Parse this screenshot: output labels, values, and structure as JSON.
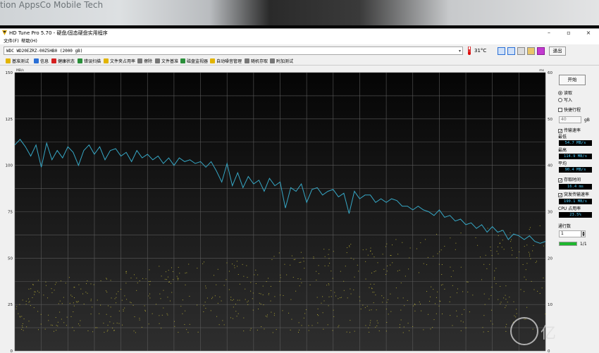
{
  "photo": {
    "text": "tion AppsCo Mobile Tech"
  },
  "window": {
    "title": "HD Tune Pro 5.70 - 硬盘/固态硬盘实用程序",
    "buttons": {
      "minimize": "–",
      "maximize": "▫",
      "close": "×"
    }
  },
  "menu": {
    "file": "文件(F)",
    "help": "帮助(H)"
  },
  "device": {
    "selected": "WDC WD20EZRZ-00Z5HB0 (2000 gB)",
    "temperature": "31°C",
    "exit_label": "退出"
  },
  "tabs": [
    {
      "label": "基准测试",
      "icon": "benchmark-icon",
      "color": "#e2b400"
    },
    {
      "label": "信息",
      "icon": "info-icon",
      "color": "#2a6fd6"
    },
    {
      "label": "健康状态",
      "icon": "health-icon",
      "color": "#d42020"
    },
    {
      "label": "错误扫描",
      "icon": "scan-icon",
      "color": "#2a8f3a"
    },
    {
      "label": "文件夹占用率",
      "icon": "folder-icon",
      "color": "#e2b400"
    },
    {
      "label": "擦除",
      "icon": "erase-icon",
      "color": "#777777"
    },
    {
      "label": "文件基准",
      "icon": "file-benchmark-icon",
      "color": "#777777"
    },
    {
      "label": "磁盘监视器",
      "icon": "monitor-icon",
      "color": "#2a8f3a"
    },
    {
      "label": "自动噪音管理",
      "icon": "noise-icon",
      "color": "#e2b400"
    },
    {
      "label": "随机存取",
      "icon": "random-access-icon",
      "color": "#777777"
    },
    {
      "label": "附加测试",
      "icon": "extra-tests-icon",
      "color": "#777777"
    }
  ],
  "panel": {
    "start_label": "开始",
    "read_label": "读取",
    "write_label": "写入",
    "short_stroke_label": "快捷行程",
    "short_stroke_value": "40",
    "short_stroke_unit": "gB",
    "transfer_rate_label": "传输速率",
    "min_label": "最低",
    "min_value": "54.7 MB/s",
    "max_label": "最高",
    "max_value": "114.9 MB/s",
    "avg_label": "平均",
    "avg_value": "90.4 MB/s",
    "access_time_label": "存取时间",
    "access_time_value": "16.4 ms",
    "burst_label": "突发传输速率",
    "burst_value": "190.1 MB/s",
    "cpu_label": "CPU 占用率",
    "cpu_value": "23.5%",
    "passes_label": "通行数",
    "passes_value": "1",
    "progress_label": "1/1",
    "progress_fraction": 1.0
  },
  "watermark": {
    "text": "亿"
  },
  "chart_data": {
    "type": "line",
    "y_left": {
      "unit": "MB/s",
      "min": 0,
      "max": 150,
      "ticks": [
        0,
        25,
        50,
        75,
        100,
        125,
        150
      ]
    },
    "y_right": {
      "unit": "ms",
      "min": 0,
      "max": 60,
      "ticks": [
        0,
        10,
        20,
        30,
        40,
        50,
        60
      ]
    },
    "grid": true,
    "colors": {
      "background": "#0e0e0e",
      "grid": "#5a5a5a",
      "line": "#36a6c4",
      "dots": "#d4c83a"
    },
    "series": [
      {
        "axis": "left",
        "x": [
          0,
          1,
          2,
          3,
          4,
          5,
          6,
          7,
          8,
          9,
          10,
          11,
          12,
          13,
          14,
          15,
          16,
          17,
          18,
          19,
          20,
          21,
          22,
          23,
          24,
          25,
          26,
          27,
          28,
          29,
          30,
          31,
          32,
          33,
          34,
          35,
          36,
          37,
          38,
          39,
          40,
          41,
          42,
          43,
          44,
          45,
          46,
          47,
          48,
          49,
          50,
          51,
          52,
          53,
          54,
          55,
          56,
          57,
          58,
          59,
          60,
          61,
          62,
          63,
          64,
          65,
          66,
          67,
          68,
          69,
          70,
          71,
          72,
          73,
          74,
          75,
          76,
          77,
          78,
          79,
          80,
          81,
          82,
          83,
          84,
          85,
          86,
          87,
          88,
          89,
          90,
          91,
          92,
          93,
          94,
          95,
          96,
          97,
          98,
          99,
          100
        ],
        "y": [
          111,
          114,
          110,
          105,
          111,
          99,
          112,
          103,
          108,
          104,
          110,
          107,
          100,
          108,
          111,
          106,
          110,
          103,
          108,
          109,
          105,
          107,
          102,
          108,
          104,
          106,
          103,
          105,
          101,
          104,
          100,
          104,
          102,
          103,
          101,
          102,
          99,
          102,
          97,
          91,
          101,
          89,
          96,
          88,
          94,
          90,
          92,
          86,
          93,
          89,
          91,
          77,
          88,
          86,
          90,
          80,
          87,
          88,
          84,
          86,
          87,
          83,
          85,
          74,
          86,
          82,
          84,
          84,
          80,
          82,
          80,
          82,
          81,
          78,
          78,
          76,
          78,
          76,
          75,
          73,
          76,
          72,
          73,
          70,
          71,
          68,
          69,
          66,
          68,
          64,
          67,
          64,
          65,
          60,
          63,
          62,
          60,
          62,
          59,
          58,
          59
        ]
      },
      {
        "axis": "right",
        "kind": "scatter",
        "x_range": [
          0,
          100
        ],
        "y_range": [
          4,
          28
        ]
      }
    ]
  }
}
